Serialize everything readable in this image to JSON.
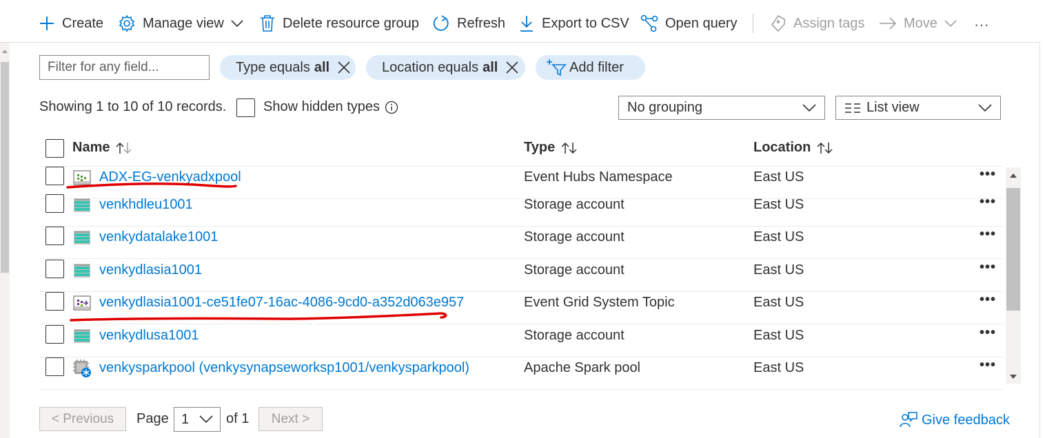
{
  "toolbar": {
    "create": "Create",
    "manage_view": "Manage view",
    "delete_rg": "Delete resource group",
    "refresh": "Refresh",
    "export_csv": "Export to CSV",
    "open_query": "Open query",
    "assign_tags": "Assign tags",
    "move": "Move",
    "more": "···"
  },
  "filters": {
    "search_placeholder": "Filter for any field...",
    "type_prefix": "Type equals",
    "type_value": "all",
    "location_prefix": "Location equals",
    "location_value": "all",
    "add_filter": "Add filter"
  },
  "summary": {
    "records": "Showing 1 to 10 of 10 records.",
    "show_hidden": "Show hidden types",
    "grouping": "No grouping",
    "view": "List view"
  },
  "table": {
    "columns": [
      "Name",
      "Type",
      "Location"
    ],
    "rows": [
      {
        "name": "ADX-EG-venkyadxpool",
        "type": "Event Hubs Namespace",
        "location": "East US",
        "icon": "event-hubs-icon"
      },
      {
        "name": "venkhdleu1001",
        "type": "Storage account",
        "location": "East US",
        "icon": "storage-account-icon"
      },
      {
        "name": "venkydatalake1001",
        "type": "Storage account",
        "location": "East US",
        "icon": "storage-account-icon"
      },
      {
        "name": "venkydlasia1001",
        "type": "Storage account",
        "location": "East US",
        "icon": "storage-account-icon"
      },
      {
        "name": "venkydlasia1001-ce51fe07-16ac-4086-9cd0-a352d063e957",
        "type": "Event Grid System Topic",
        "location": "East US",
        "icon": "event-grid-topic-icon"
      },
      {
        "name": "venkydlusa1001",
        "type": "Storage account",
        "location": "East US",
        "icon": "storage-account-icon"
      },
      {
        "name": "venkysparkpool (venkysynapseworksp1001/venkysparkpool)",
        "type": "Apache Spark pool",
        "location": "East US",
        "icon": "spark-pool-icon"
      }
    ],
    "row_more": "•••"
  },
  "pagination": {
    "previous": "< Previous",
    "page_label": "Page",
    "page_value": "1",
    "of_label": "of 1",
    "next": "Next >",
    "feedback": "Give feedback"
  },
  "colors": {
    "link": "#0078d4",
    "pill_bg": "#deecf9",
    "annotation": "#e00000"
  }
}
